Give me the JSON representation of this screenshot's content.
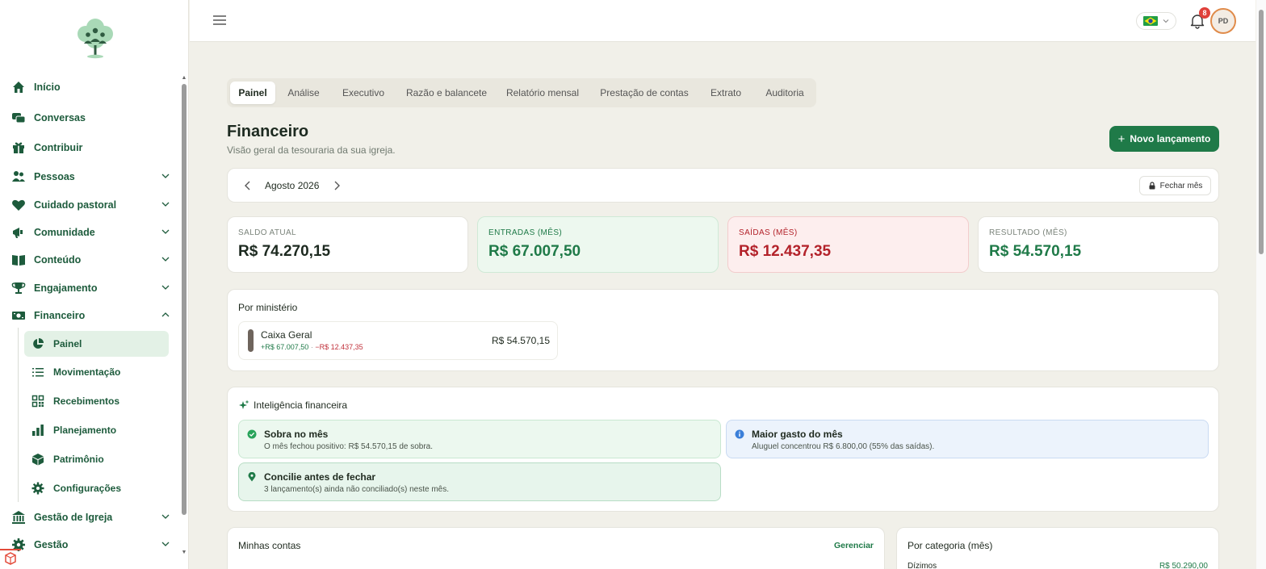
{
  "colors": {
    "brand": "#1f7a48",
    "income": "#1f7a48",
    "expense": "#b3222a",
    "accent_orange": "#e08b4a"
  },
  "sidebar": {
    "items": [
      {
        "label": "Início",
        "icon": "home-icon"
      },
      {
        "label": "Conversas",
        "icon": "chat-icon"
      },
      {
        "label": "Contribuir",
        "icon": "gift-icon"
      },
      {
        "label": "Pessoas",
        "icon": "people-icon"
      },
      {
        "label": "Cuidado pastoral",
        "icon": "heart-icon"
      },
      {
        "label": "Comunidade",
        "icon": "megaphone-icon"
      },
      {
        "label": "Conteúdo",
        "icon": "book-icon"
      },
      {
        "label": "Engajamento",
        "icon": "trophy-icon"
      },
      {
        "label": "Financeiro",
        "icon": "money-icon"
      },
      {
        "label": "Gestão de Igreja",
        "icon": "bank-icon"
      },
      {
        "label": "Gestão",
        "icon": "gear-icon"
      }
    ],
    "financeiro_sub": [
      {
        "label": "Painel",
        "icon": "pie-chart-icon"
      },
      {
        "label": "Movimentação",
        "icon": "list-icon"
      },
      {
        "label": "Recebimentos",
        "icon": "qr-code-icon"
      },
      {
        "label": "Planejamento",
        "icon": "bar-chart-icon"
      },
      {
        "label": "Patrimônio",
        "icon": "cube-icon"
      },
      {
        "label": "Configurações",
        "icon": "gear-icon"
      }
    ]
  },
  "topbar": {
    "notifications_count": "8",
    "avatar_initials": "PD",
    "language_flag": "brazil-flag-icon"
  },
  "tabs": [
    "Painel",
    "Análise",
    "Executivo",
    "Razão e balancete",
    "Relatório mensal",
    "Prestação de contas",
    "Extrato",
    "Auditoria"
  ],
  "page": {
    "title": "Financeiro",
    "subtitle": "Visão geral da tesouraria da sua igreja.",
    "new_entry_label": "Novo lançamento"
  },
  "period": {
    "label": "Agosto 2026",
    "close_month_label": "Fechar mês"
  },
  "stats": [
    {
      "caption": "SALDO ATUAL",
      "value": "R$ 74.270,15"
    },
    {
      "caption": "ENTRADAS (MÊS)",
      "value": "R$ 67.007,50"
    },
    {
      "caption": "SAÍDAS (MÊS)",
      "value": "R$ 12.437,35"
    },
    {
      "caption": "RESULTADO (MÊS)",
      "value": "R$ 54.570,15"
    }
  ],
  "ministry": {
    "title": "Por ministério",
    "items": [
      {
        "name": "Caixa Geral",
        "income": "+R$ 67.007,50",
        "separator": "·",
        "expense": "−R$ 12.437,35",
        "value": "R$ 54.570,15"
      }
    ]
  },
  "intelligence": {
    "title": "Inteligência financeira",
    "insights": [
      {
        "title": "Sobra no mês",
        "desc": "O mês fechou positivo: R$ 54.570,15 de sobra."
      },
      {
        "title": "Maior gasto do mês",
        "desc": "Aluguel concentrou R$ 6.800,00 (55% das saídas)."
      },
      {
        "title": "Concilie antes de fechar",
        "desc": "3 lançamento(s) ainda não conciliado(s) neste mês."
      }
    ]
  },
  "accounts": {
    "title": "Minhas contas",
    "manage_label": "Gerenciar"
  },
  "categories": {
    "title": "Por categoria (mês)",
    "rows": [
      {
        "label": "Dízimos",
        "value": "R$ 50.290,00"
      }
    ]
  }
}
